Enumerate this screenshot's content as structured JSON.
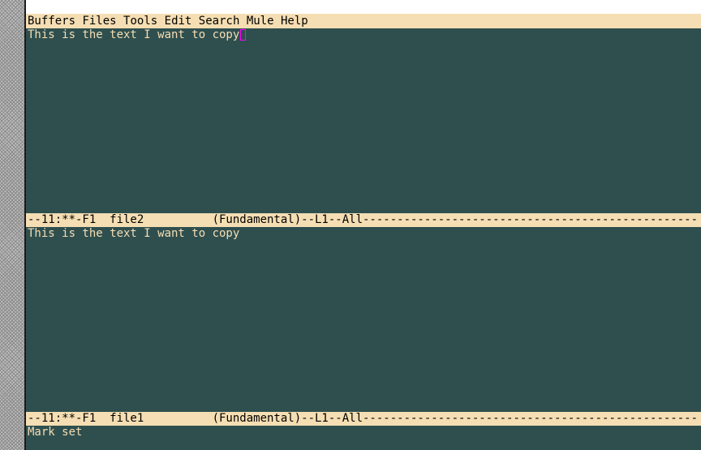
{
  "menubar": {
    "items": [
      "Buffers",
      "Files",
      "Tools",
      "Edit",
      "Search",
      "Mule",
      "Help"
    ]
  },
  "windows": [
    {
      "text": "This is the text I want to copy",
      "modeline": "--11:**-F1  file2          (Fundamental)--L1--All-------------------------------------------------"
    },
    {
      "text": "This is the text I want to copy",
      "modeline": "--11:**-F1  file1          (Fundamental)--L1--All-------------------------------------------------"
    }
  ],
  "minibuffer": {
    "message": "Mark set"
  },
  "colors": {
    "background": "#2f4f4f",
    "foreground": "#f5deb3",
    "menubar": "#f5deb3",
    "modeline": "#f5deb3",
    "cursor": "#ff00ff"
  }
}
